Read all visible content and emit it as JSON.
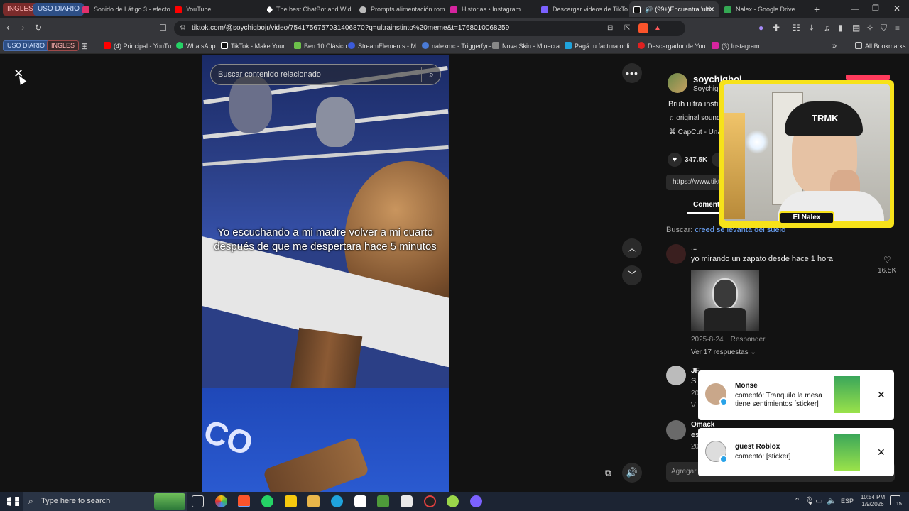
{
  "tabs": {
    "groups": [
      "INGLES",
      "USO DIARIO"
    ],
    "items": [
      {
        "label": "Sonido de Látigo 3 - efecto",
        "color": "#e1306c"
      },
      {
        "label": "YouTube",
        "color": "#ff0000"
      },
      {
        "label": "The best ChatBot and Wid",
        "color": "#ffffff"
      },
      {
        "label": "Prompts alimentación rom",
        "color": "#cccccc"
      },
      {
        "label": "Historias • Instagram",
        "color": "#d6249f"
      },
      {
        "label": "Descargar videos de TikTok",
        "color": "#7b61ff"
      },
      {
        "label": "(99+)Encuentra 'ulti",
        "color": "#ffffff"
      },
      {
        "label": "Nalex - Google Drive",
        "color": "#34a853"
      }
    ],
    "new_tab": "+"
  },
  "address": {
    "url": "tiktok.com/@soychigbojr/video/7541756757031406870?q=ultrainstinto%20meme&t=1768010068259"
  },
  "bookmarks": {
    "groups": [
      "USO DIARIO",
      "INGLES"
    ],
    "items": [
      {
        "label": "(4) Principal - YouTu...",
        "color": "#ff0000"
      },
      {
        "label": "WhatsApp",
        "color": "#25d366"
      },
      {
        "label": "TikTok - Make Your...",
        "color": "#ffffff"
      },
      {
        "label": "Ben 10 Clásico",
        "color": "#6cc04a"
      },
      {
        "label": "StreamElements - M...",
        "color": "#3b5bdb"
      },
      {
        "label": "nalexmc - Triggerfyre",
        "color": "#4a7bd6"
      },
      {
        "label": "Nova Skin - Minecra...",
        "color": "#888888"
      },
      {
        "label": "Pagá tu factura onli...",
        "color": "#1fa3dc"
      },
      {
        "label": "Descargador de You...",
        "color": "#e02020"
      },
      {
        "label": "(3) Instagram",
        "color": "#d6249f"
      }
    ],
    "more": "»",
    "all": "All Bookmarks"
  },
  "viewer": {
    "search_placeholder": "Buscar contenido relacionado",
    "caption": "Yo escuchando a mi madre volver a mi cuarto después de que me despertara hace 5 minutos"
  },
  "panel": {
    "username": "soychigboj",
    "handle": "Soychigb",
    "description": "Bruh ultra insti",
    "sound": "original sound",
    "capcut": "CapCut - Una e",
    "likes": "347.5K",
    "link": "https://www.tikt",
    "comments_tab": "Coment",
    "search_label": "Buscar:",
    "search_term": "creed se levanta del suelo",
    "comment1": {
      "user": "...",
      "text": "yo mirando un zapato desde hace 1 hora",
      "likes": "16.5K",
      "date": "2025-8-24",
      "reply": "Responder",
      "view_replies": "Ver 17 respuestas"
    },
    "comment2": {
      "user": "JF",
      "frag1": "S",
      "frag2": "20",
      "frag3": "V"
    },
    "comment3": {
      "user": "Omack",
      "frag1": "es",
      "frag2": "20"
    },
    "add_comment": "Agregar"
  },
  "notifications": [
    {
      "user": "Monse",
      "line1": "comentó: Tranquilo la mesa",
      "line2": "tiene sentimientos [sticker]"
    },
    {
      "user": "guest Roblox",
      "line1": "comentó: [sticker]",
      "line2": ""
    }
  ],
  "overlay": {
    "name": "El Nalex",
    "cap_text": "TRMK"
  },
  "taskbar": {
    "search_placeholder": "Type here to search",
    "lang": "ESP",
    "time": "10:54 PM",
    "date": "1/9/2026",
    "notif_count": "15"
  }
}
